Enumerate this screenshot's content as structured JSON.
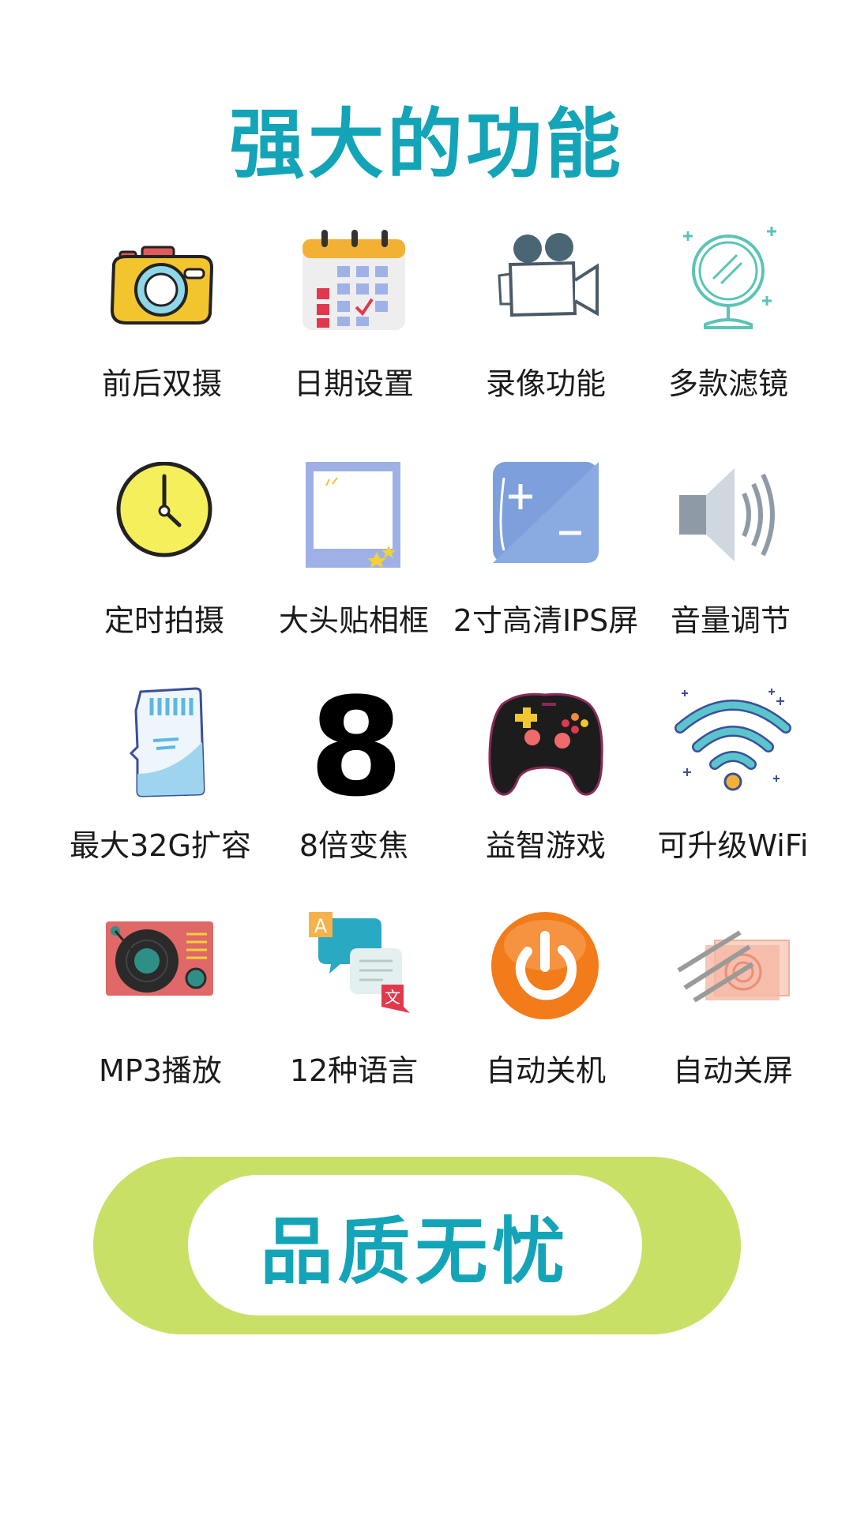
{
  "title": "强大的功能",
  "features": [
    {
      "label": "前后双摄",
      "icon": "camera-icon"
    },
    {
      "label": "日期设置",
      "icon": "calendar-icon"
    },
    {
      "label": "录像功能",
      "icon": "video-camera-icon"
    },
    {
      "label": "多款滤镜",
      "icon": "mirror-icon"
    },
    {
      "label": "定时拍摄",
      "icon": "clock-icon"
    },
    {
      "label": "大头贴相框",
      "icon": "photo-frame-icon"
    },
    {
      "label": "2寸高清IPS屏",
      "icon": "screen-icon"
    },
    {
      "label": "音量调节",
      "icon": "speaker-icon"
    },
    {
      "label": "最大32G扩容",
      "icon": "sd-card-icon"
    },
    {
      "label": "8倍变焦",
      "icon": "number-eight-icon"
    },
    {
      "label": "益智游戏",
      "icon": "gamepad-icon"
    },
    {
      "label": "可升级WiFi",
      "icon": "wifi-icon"
    },
    {
      "label": "MP3播放",
      "icon": "turntable-icon"
    },
    {
      "label": "12种语言",
      "icon": "translate-icon"
    },
    {
      "label": "自动关机",
      "icon": "power-icon"
    },
    {
      "label": "自动关屏",
      "icon": "screen-off-icon"
    }
  ],
  "badge": {
    "text": "品质无忧"
  },
  "colors": {
    "accent": "#14a4b8",
    "badge_green": "#c9e067"
  }
}
